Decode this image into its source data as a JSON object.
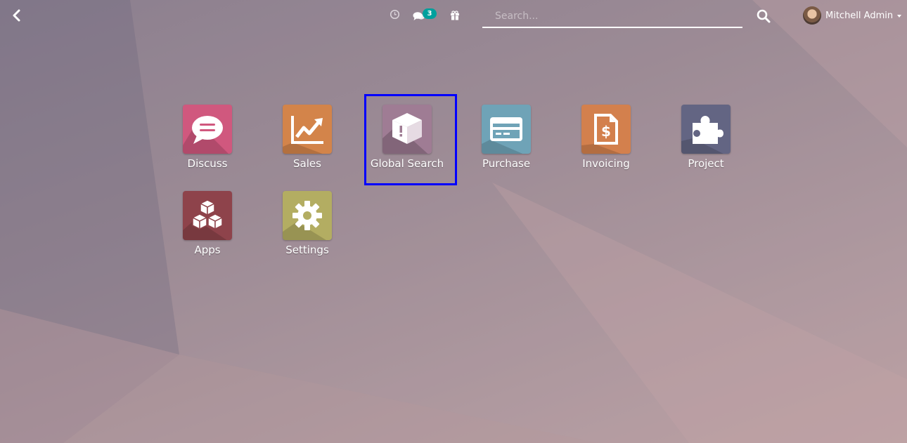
{
  "header": {
    "back_icon": "chevron-left-icon",
    "activity_icon": "clock-icon",
    "messages_icon": "chat-bubbles-icon",
    "messages_badge": "3",
    "updates_icon": "gift-icon",
    "search": {
      "placeholder": "Search...",
      "value": ""
    },
    "search_icon": "search-icon",
    "user": {
      "name": "Mitchell Admin",
      "avatar_icon": "user-avatar"
    }
  },
  "apps": [
    {
      "label": "Discuss",
      "icon": "chat-bubble-icon",
      "color": "#d0587e"
    },
    {
      "label": "Sales",
      "icon": "trending-chart-icon",
      "color": "#d3844a"
    },
    {
      "label": "Global Search",
      "icon": "box-alert-icon",
      "color": "#9f7c94",
      "selected": true
    },
    {
      "label": "Purchase",
      "icon": "credit-card-icon",
      "color": "#6fa3b7"
    },
    {
      "label": "Invoicing",
      "icon": "invoice-dollar-icon",
      "color": "#d3804d"
    },
    {
      "label": "Project",
      "icon": "puzzle-icon",
      "color": "#636583"
    },
    {
      "label": "Apps",
      "icon": "cubes-icon",
      "color": "#8e434b"
    },
    {
      "label": "Settings",
      "icon": "gear-icon",
      "color": "#b3ad62"
    }
  ],
  "colors": {
    "highlight": "#0000ff",
    "badge": "#00a09d"
  }
}
